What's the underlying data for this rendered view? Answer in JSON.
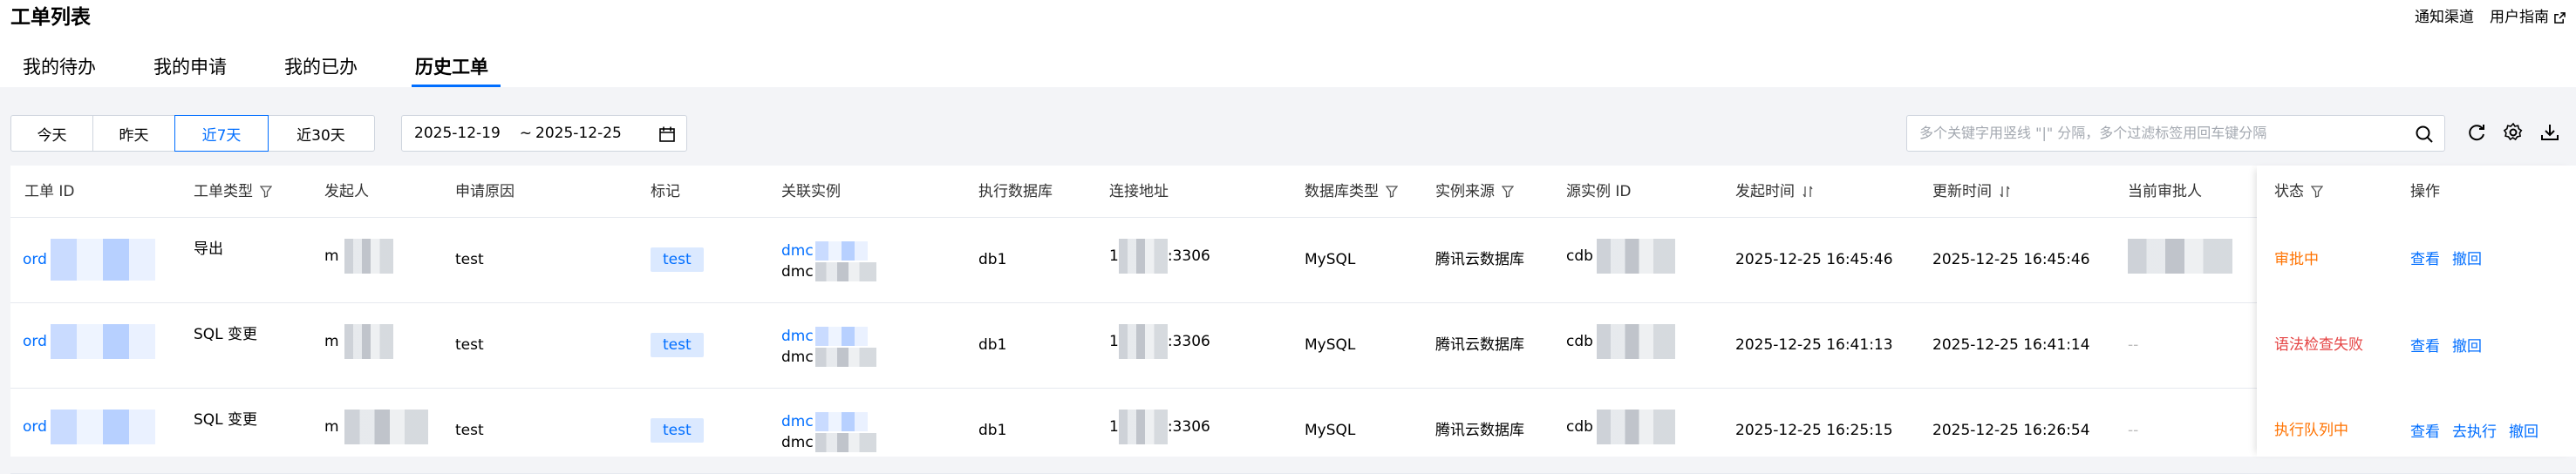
{
  "header": {
    "title": "工单列表",
    "links": [
      {
        "label": "通知渠道",
        "icon": ""
      },
      {
        "label": "用户指南",
        "icon": "external-link-icon"
      }
    ]
  },
  "tabs": [
    {
      "label": "我的待办",
      "active": false
    },
    {
      "label": "我的申请",
      "active": false
    },
    {
      "label": "我的已办",
      "active": false
    },
    {
      "label": "历史工单",
      "active": true
    }
  ],
  "filters": {
    "quick_ranges": [
      "今天",
      "昨天",
      "近7天",
      "近30天"
    ],
    "selected_range": "近7天",
    "date_start": "2025-12-19",
    "date_sep": "~",
    "date_end": "2025-12-25",
    "search_placeholder": "多个关键字用竖线 \"|\" 分隔，多个过滤标签用回车键分隔"
  },
  "table": {
    "columns": {
      "id": "工单 ID",
      "type": "工单类型",
      "initiator": "发起人",
      "reason": "申请原因",
      "tag": "标记",
      "instance": "关联实例",
      "db": "执行数据库",
      "address": "连接地址",
      "db_type": "数据库类型",
      "source": "实例来源",
      "source_id": "源实例 ID",
      "created": "发起时间",
      "updated": "更新时间",
      "approver": "当前审批人",
      "status": "状态",
      "actions": "操作"
    },
    "rows": [
      {
        "id": "ord",
        "type": "导出",
        "initiator": "m",
        "reason": "test",
        "tag": "test",
        "instance_1": "dmc",
        "instance_2": "dmc",
        "db": "db1",
        "address_prefix": "1",
        "address_port": ":3306",
        "db_type": "MySQL",
        "source": "腾讯云数据库",
        "source_id": "cdb",
        "created": "2025-12-25 16:45:46",
        "updated": "2025-12-25 16:45:46",
        "approver": "m",
        "status": "审批中",
        "actions": [
          "查看",
          "撤回"
        ]
      },
      {
        "id": "ord",
        "type": "SQL 变更",
        "initiator": "m",
        "reason": "test",
        "tag": "test",
        "instance_1": "dmc",
        "instance_2": "dmc",
        "db": "db1",
        "address_prefix": "1",
        "address_port": ":3306",
        "db_type": "MySQL",
        "source": "腾讯云数据库",
        "source_id": "cdb",
        "created": "2025-12-25 16:41:13",
        "updated": "2025-12-25 16:41:14",
        "approver": "--",
        "status": "语法检查失败",
        "actions": [
          "查看",
          "撤回"
        ]
      },
      {
        "id": "ord",
        "type": "SQL 变更",
        "initiator": "m",
        "reason": "test",
        "tag": "test",
        "instance_1": "dmc",
        "instance_2": "dmc",
        "db": "db1",
        "address_prefix": "1",
        "address_port": ":3306",
        "db_type": "MySQL",
        "source": "腾讯云数据库",
        "source_id": "cdb",
        "created": "2025-12-25 16:25:15",
        "updated": "2025-12-25 16:26:54",
        "approver": "--",
        "status": "执行队列中",
        "actions": [
          "查看",
          "去执行",
          "撤回"
        ]
      }
    ]
  },
  "colors": {
    "accent": "#006eff",
    "status_pending": "#ff7200",
    "status_error": "#e54545",
    "tag_bg": "#dbe9ff"
  }
}
